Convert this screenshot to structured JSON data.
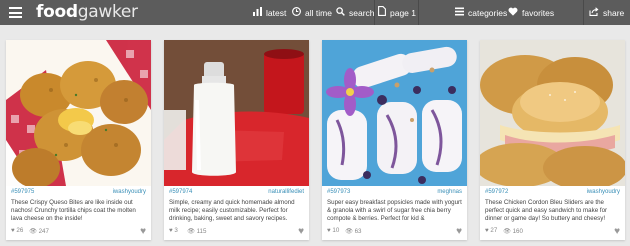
{
  "header": {
    "logo_bold": "food",
    "logo_light": "gawker",
    "nav": {
      "latest": "latest",
      "alltime": "all time",
      "search": "search",
      "page": "page 1",
      "categories": "categories",
      "favorites": "favorites",
      "share": "share"
    }
  },
  "cards": [
    {
      "id": "#597975",
      "source": "iwashyoudry",
      "description": "These Crispy Queso Bites are like inside out nachos! Crunchy tortilla chips coat the molten lava cheese on the inside!",
      "favorites": "26",
      "views": "247"
    },
    {
      "id": "#597974",
      "source": "naturallifediet",
      "description": "Simple, creamy and quick homemade almond milk recipe; easily customizable. Perfect for drinking, baking, sweet and savory recipes.",
      "favorites": "3",
      "views": "115"
    },
    {
      "id": "#597973",
      "source": "meghnas",
      "description": "Super easy breakfast popsicles made with yogurt & granola with a swirl of sugar free chia berry compote & berries. Perfect for kid &",
      "favorites": "10",
      "views": "63"
    },
    {
      "id": "#597972",
      "source": "iwashyoudry",
      "description": "These Chicken Cordon Bleu Sliders are the perfect quick and easy sandwich to make for dinner or game day! So buttery and cheesy!",
      "favorites": "27",
      "views": "160"
    }
  ]
}
